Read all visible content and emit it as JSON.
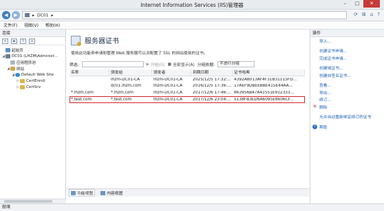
{
  "window": {
    "title": "Internet Information Services (IIS)管理器"
  },
  "addressbar": {
    "node": "DC01",
    "separator": "▸",
    "tail": "▸"
  },
  "menubar": {
    "items": [
      "文件(F)",
      "视图(V)",
      "帮助(H)"
    ]
  },
  "connections": {
    "header": "连接",
    "tree": [
      {
        "label": "起始页",
        "icon": "start-page-icon",
        "indent": 0,
        "twisty": ""
      },
      {
        "label": "DC01 (LHZM\\Administ...",
        "icon": "server-icon",
        "indent": 0,
        "twisty": "◢"
      },
      {
        "label": "应用程序池",
        "icon": "app-pool-icon",
        "indent": 1,
        "twisty": ""
      },
      {
        "label": "网站",
        "icon": "sites-icon",
        "indent": 1,
        "twisty": "◢"
      },
      {
        "label": "Default Web Site",
        "icon": "globe-icon",
        "indent": 2,
        "twisty": "◢"
      },
      {
        "label": "CertEnroll",
        "icon": "folder-icon",
        "indent": 3,
        "twisty": "▷"
      },
      {
        "label": "CertSrv",
        "icon": "folder-icon",
        "indent": 3,
        "twisty": "▷"
      }
    ]
  },
  "content": {
    "title": "服务器证书",
    "description": "使用此功能来申请和管理 Web 服务器可以对配置了 SSL 的网站使用的证书。",
    "filter": {
      "label": "筛选:",
      "start_label": "开始(G)",
      "show_all_label": "全部显示(A)",
      "group_label": "分组依据:",
      "group_value": "不进行分组"
    },
    "columns": [
      "名称",
      "颁发给",
      "颁发者",
      "到期日期",
      "证书哈希"
    ],
    "rows": [
      {
        "name": "",
        "issued_to": "lhzm-DC01-CA",
        "issuer": "lhzm-DC01-CA",
        "expiry": "2025/12/5 17:32:...",
        "hash": "4392AB013AF4F31B31115FD...",
        "highlight": false
      },
      {
        "name": "",
        "issued_to": "dc01.lhzm.com",
        "issuer": "lhzm-DC01-CA",
        "expiry": "2016/12/5 17:36:...",
        "hash": "17AEF9DBEEBBE415E44AA...",
        "highlight": false
      },
      {
        "name": "*.lhzm.com",
        "issued_to": "*.lhzm.com",
        "issuer": "lhzm-DC01-CA",
        "expiry": "2017/12/6 17:46:...",
        "hash": "863956B47A41551E912333...",
        "highlight": false
      },
      {
        "name": "*.test.com",
        "issued_to": "*.test.com",
        "issuer": "lhzm-DC01-CA",
        "expiry": "2017/12/6 23:04:...",
        "hash": "5138FB3ED6A6095E8606CF...",
        "highlight": true
      }
    ]
  },
  "bottom_tabs": {
    "features_view": "功能视图",
    "content_view": "内容视图"
  },
  "actions": {
    "header": "操作",
    "items": [
      {
        "label": "导入...",
        "icon": "",
        "gap": false
      },
      {
        "label": "创建证书申请...",
        "icon": "",
        "gap": true
      },
      {
        "label": "完成证书申请...",
        "icon": "",
        "gap": false
      },
      {
        "label": "创建域证书...",
        "icon": "",
        "gap": true
      },
      {
        "label": "创建自签名证书...",
        "icon": "",
        "gap": false
      },
      {
        "label": "查看...",
        "icon": "",
        "gap": true
      },
      {
        "label": "导出...",
        "icon": "",
        "gap": false
      },
      {
        "label": "续订...",
        "icon": "",
        "gap": false
      },
      {
        "label": "删除",
        "icon": "delete-icon",
        "gap": false
      },
      {
        "label": "允许自动重新绑定续订的证书",
        "icon": "",
        "gap": true
      },
      {
        "label": "帮助",
        "icon": "help-icon",
        "gap": true
      }
    ]
  },
  "status": {
    "text": "就绪"
  }
}
